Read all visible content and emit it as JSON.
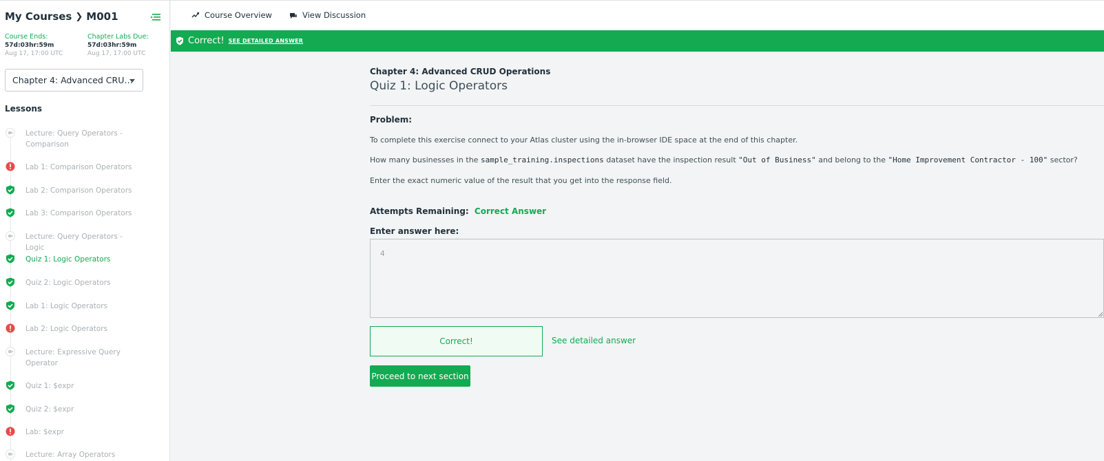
{
  "sidebar": {
    "breadcrumb_root": "My Courses",
    "breadcrumb_course": "M001",
    "course_ends": {
      "label": "Course Ends:",
      "countdown": "57d:03hr:59m",
      "date": "Aug 17, 17:00 UTC"
    },
    "labs_due": {
      "label": "Chapter Labs Due:",
      "countdown": "57d:03hr:59m",
      "date": "Aug 17, 17:00 UTC"
    },
    "chapter_select": "Chapter 4: Advanced CRU…",
    "lessons_heading": "Lessons",
    "lessons": [
      {
        "label": "Lecture: Query Operators - Comparison",
        "status": "lecture"
      },
      {
        "label": "Lab 1: Comparison Operators",
        "status": "error"
      },
      {
        "label": "Lab 2: Comparison Operators",
        "status": "done"
      },
      {
        "label": "Lab 3: Comparison Operators",
        "status": "done"
      },
      {
        "label": "Lecture: Query Operators - Logic",
        "status": "lecture"
      },
      {
        "label": "Quiz 1: Logic Operators",
        "status": "done",
        "active": true
      },
      {
        "label": "Quiz 2: Logic Operators",
        "status": "done"
      },
      {
        "label": "Lab 1: Logic Operators",
        "status": "done"
      },
      {
        "label": "Lab 2: Logic Operators",
        "status": "error"
      },
      {
        "label": "Lecture: Expressive Query Operator",
        "status": "lecture"
      },
      {
        "label": "Quiz 1: $expr",
        "status": "done"
      },
      {
        "label": "Quiz 2: $expr",
        "status": "done"
      },
      {
        "label": "Lab: $expr",
        "status": "error"
      },
      {
        "label": "Lecture: Array Operators",
        "status": "lecture"
      }
    ]
  },
  "topnav": {
    "overview": "Course Overview",
    "discussion": "View Discussion"
  },
  "banner": {
    "message": "Correct!",
    "link": "SEE DETAILED ANSWER"
  },
  "main": {
    "chapter": "Chapter 4: Advanced CRUD Operations",
    "title": "Quiz 1: Logic Operators",
    "problem_heading": "Problem:",
    "p1": "To complete this exercise connect to your Atlas cluster using the in-browser IDE space at the end of this chapter.",
    "p2_a": "How many businesses in the ",
    "p2_code1": "sample_training.inspections",
    "p2_b": " dataset have the inspection result ",
    "p2_code2": "\"Out of Business\"",
    "p2_c": " and belong to the ",
    "p2_code3": "\"Home Improvement Contractor - 100\"",
    "p2_d": " sector?",
    "p3": "Enter the exact numeric value of the result that you get into the response field.",
    "attempts_label": "Attempts Remaining:",
    "attempts_value": "Correct Answer",
    "answer_label": "Enter answer here:",
    "answer_value": "4",
    "correct_button": "Correct!",
    "detail_link": "See detailed answer",
    "proceed_button": "Proceed to next section"
  },
  "colors": {
    "accent": "#13aa52",
    "error": "#e94b4b"
  }
}
